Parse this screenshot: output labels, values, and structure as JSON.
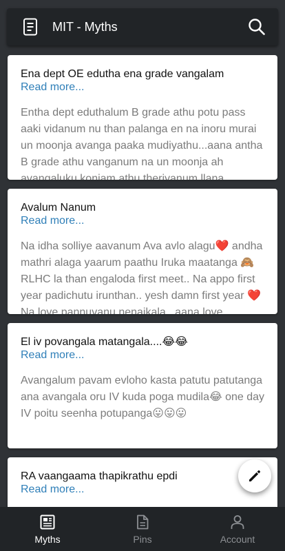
{
  "app": {
    "title": "MIT - Myths",
    "icons": {
      "logo": "document-icon",
      "search": "search-icon",
      "compose": "pencil-icon"
    }
  },
  "posts": [
    {
      "title": "Ena dept OE edutha ena grade vangalam",
      "read_more": "Read more...",
      "body": "Entha dept eduthalum B grade athu potu pass\naaki vidanum nu than palanga en na inoru murai\nun moonja avanga paaka mudiyathu...aana antha\nB grade athu vanganum na un moonja ah\navangaluku koniam athu theriyanum llana"
    },
    {
      "title": "Avalum Nanum",
      "read_more": "Read more...",
      "body": "Na idha solliye aavanum Ava avlo alagu❤️ andha\nmathri alaga yaarum paathu Iruka maatanga 🙈\nRLHC la than engaloda first meet.. Na appo first\nyear padichutu irunthan.. yesh damn first year ❤️\nNa love pannuvanu nenaikala...aana love"
    },
    {
      "title": "El iv povangala matangala....😂😂",
      "read_more": "Read more...",
      "body": "Avangalum pavam evloho kasta patutu patutanga\nana avangala oru IV kuda poga mudila😂 one day\nIV poitu seenha potupanga😛😛😛"
    },
    {
      "title": "RA vaangaama thapikrathu epdi",
      "read_more": "Read more..."
    }
  ],
  "bottom_nav": [
    {
      "label": "Myths",
      "icon": "article-icon",
      "active": true
    },
    {
      "label": "Pins",
      "icon": "file-icon",
      "active": false
    },
    {
      "label": "Account",
      "icon": "person-icon",
      "active": false
    }
  ],
  "colors": {
    "background": "#2f3236",
    "app_bar": "#212427",
    "card": "#ffffff",
    "link": "#2f7fb8",
    "body_text": "#7b7b7b",
    "nav_active": "#ffffff",
    "nav_inactive": "#8d9094"
  }
}
